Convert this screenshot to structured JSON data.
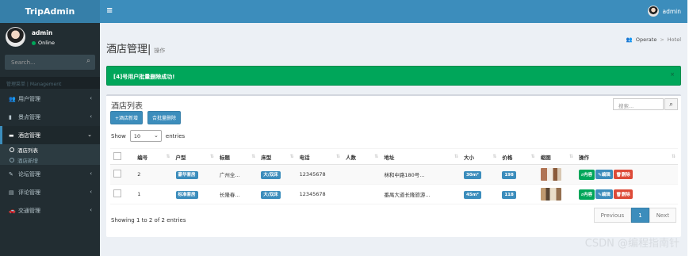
{
  "app": {
    "logo": "TripAdmin",
    "menu_toggle": "≡",
    "user": "admin"
  },
  "sidebar": {
    "user_name": "admin",
    "status": "Online",
    "search_placeholder": "Search...",
    "search_icon": "search-icon",
    "header": "管理菜单 | Management",
    "items": [
      {
        "label": "用户管理",
        "icon": "users-icon"
      },
      {
        "label": "景点管理",
        "icon": "book-icon"
      },
      {
        "label": "酒店管理",
        "icon": "bed-icon",
        "active": true,
        "sub": [
          {
            "label": "酒店列表",
            "on": true
          },
          {
            "label": "酒店新增",
            "on": false
          }
        ]
      },
      {
        "label": "论坛管理",
        "icon": "forum-icon"
      },
      {
        "label": "评论管理",
        "icon": "comment-icon"
      },
      {
        "label": "交通管理",
        "icon": "car-icon"
      }
    ]
  },
  "page": {
    "title": "酒店管理",
    "subtitle": "操作",
    "breadcrumb": [
      "Operate",
      "Hotel"
    ]
  },
  "alert": {
    "text": "[4]号用户批量删除成功!",
    "close": "×"
  },
  "box": {
    "title": "酒店列表",
    "add_button": "+酒店新增",
    "batch_delete": "合批量删除",
    "search_placeholder": "搜索...",
    "show_label": "Show",
    "entries_value": "10",
    "entries_label": "entries",
    "columns": [
      "",
      "编号",
      "户型",
      "标题",
      "床型",
      "电话",
      "人数",
      "地址",
      "大小",
      "价格",
      "缩图",
      "操作"
    ],
    "rows": [
      {
        "id": "2",
        "room_type": "豪华套房",
        "title": "广州全...",
        "bed": "大/双床",
        "phone": "12345678",
        "people": "",
        "address": "林和中路180号...",
        "size": "30m²",
        "price": "198",
        "thumb": "t1"
      },
      {
        "id": "1",
        "room_type": "标准套房",
        "title": "长隆春...",
        "bed": "大/双床",
        "phone": "12345678",
        "people": "",
        "address": "番禺大道长隆旅游...",
        "size": "45m²",
        "price": "118",
        "thumb": "t2"
      }
    ],
    "actions": {
      "view": "内容",
      "edit": "编辑",
      "delete": "删除"
    },
    "info": "Showing 1 to 2 of 2 entries",
    "pager": {
      "prev": "Previous",
      "page": "1",
      "next": "Next"
    }
  },
  "watermark": "CSDN @编程指南针",
  "colors": {
    "header": "#3c8dbc",
    "logo": "#367fa9",
    "sidebar": "#222d32",
    "success": "#00a65a",
    "danger": "#dd4b39"
  }
}
